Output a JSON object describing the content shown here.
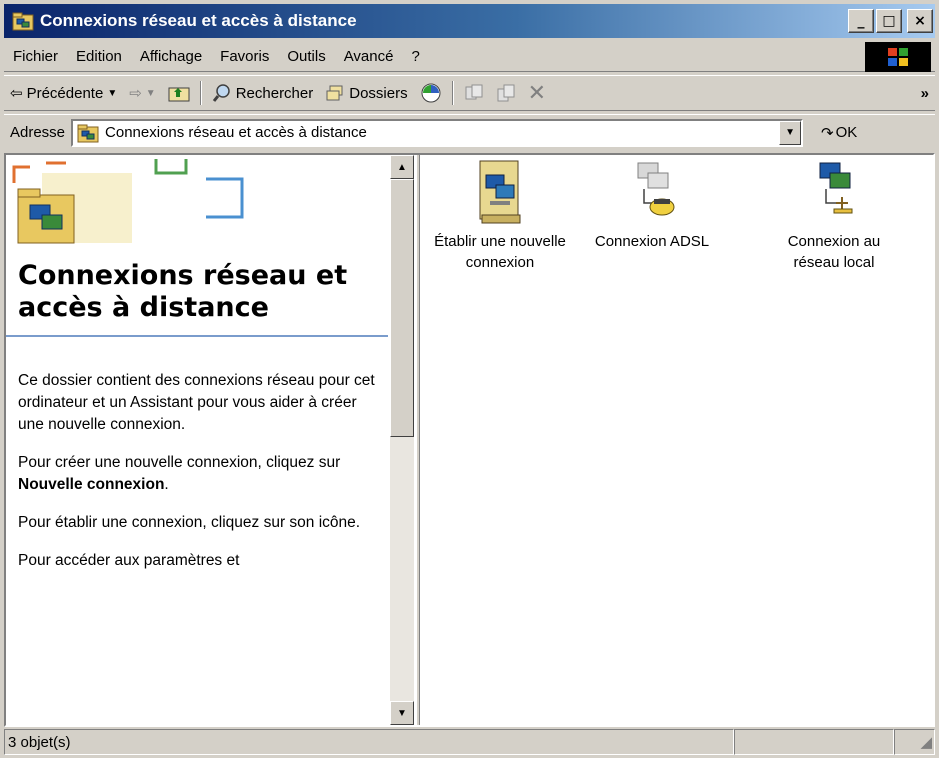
{
  "window": {
    "title": "Connexions réseau et accès à distance",
    "minimize": "_",
    "maximize": "□",
    "close": "×"
  },
  "menu": [
    "Fichier",
    "Edition",
    "Affichage",
    "Favoris",
    "Outils",
    "Avancé",
    "?"
  ],
  "toolbar": {
    "back": "Précédente",
    "search": "Rechercher",
    "folders": "Dossiers",
    "more": "»"
  },
  "address": {
    "label": "Adresse",
    "value": "Connexions réseau et accès à distance",
    "go": "OK"
  },
  "left_pane": {
    "title": "Connexions réseau et accès à distance",
    "para1": "Ce dossier contient des connexions réseau pour cet ordinateur et un Assistant pour vous aider à créer une nouvelle connexion.",
    "para2_prefix": "Pour créer une nouvelle connexion, cliquez sur ",
    "para2_bold": "Nouvelle connexion",
    "para2_suffix": ".",
    "para3": "Pour établir une connexion, cliquez sur son icône.",
    "para4": "Pour accéder aux paramètres et"
  },
  "items": [
    {
      "label": "Établir une nouvelle connexion",
      "icon": "new-connection-icon"
    },
    {
      "label": "Connexion ADSL",
      "icon": "dialup-connection-icon"
    },
    {
      "label": "Connexion au réseau local",
      "icon": "lan-connection-icon"
    }
  ],
  "status": {
    "count": "3 objet(s)"
  },
  "colors": {
    "title_gradient_start": "#0a246a",
    "title_gradient_end": "#a6caf0",
    "face": "#d4d0c8",
    "pane_rule": "#7a9ccc"
  }
}
